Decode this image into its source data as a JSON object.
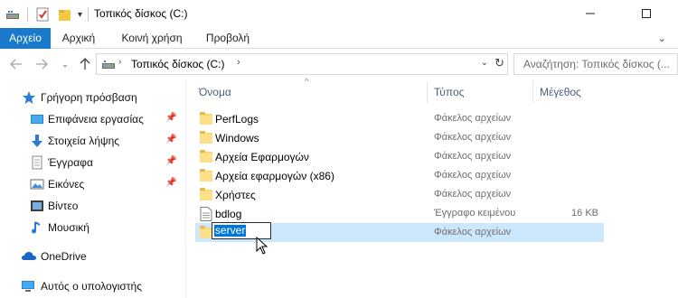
{
  "window": {
    "title": "Τοπικός δίσκος (C:)",
    "minimize_icon": "minimize-icon",
    "maximize_icon": "maximize-icon"
  },
  "ribbon": {
    "tabs": [
      {
        "label": "Αρχείο",
        "active": true
      },
      {
        "label": "Αρχική",
        "active": false
      },
      {
        "label": "Κοινή χρήση",
        "active": false
      },
      {
        "label": "Προβολή",
        "active": false
      }
    ],
    "accent_color": "#1979ca"
  },
  "address_bar": {
    "path": "Τοπικός δίσκος (C:)",
    "search_placeholder": "Αναζήτηση: Τοπικός δίσκος (..."
  },
  "nav_pane": {
    "items": [
      {
        "label": "Γρήγορη πρόσβαση",
        "icon": "star-icon"
      },
      {
        "label": "Επιφάνεια εργασίας",
        "icon": "desktop-icon",
        "pinned": true
      },
      {
        "label": "Στοιχεία λήψης",
        "icon": "download-icon",
        "pinned": true
      },
      {
        "label": "Έγγραφα",
        "icon": "documents-icon",
        "pinned": true
      },
      {
        "label": "Εικόνες",
        "icon": "pictures-icon",
        "pinned": true
      },
      {
        "label": "Βίντεο",
        "icon": "videos-icon"
      },
      {
        "label": "Μουσική",
        "icon": "music-icon"
      },
      {
        "label": "OneDrive",
        "icon": "cloud-icon"
      },
      {
        "label": "Αυτός ο υπολογιστής",
        "icon": "computer-icon"
      }
    ]
  },
  "file_list": {
    "columns": {
      "name": "Όνομα",
      "type": "Τύπος",
      "size": "Μέγεθος"
    },
    "rows": [
      {
        "name": "PerfLogs",
        "type": "Φάκελος αρχείων",
        "size": "",
        "kind": "folder"
      },
      {
        "name": "Windows",
        "type": "Φάκελος αρχείων",
        "size": "",
        "kind": "folder"
      },
      {
        "name": "Αρχεία Εφαρμογών",
        "type": "Φάκελος αρχείων",
        "size": "",
        "kind": "folder"
      },
      {
        "name": "Αρχεία εφαρμογών (x86)",
        "type": "Φάκελος αρχείων",
        "size": "",
        "kind": "folder"
      },
      {
        "name": "Χρήστες",
        "type": "Φάκελος αρχείων",
        "size": "",
        "kind": "folder"
      },
      {
        "name": "bdlog",
        "type": "Έγγραφο κειμένου",
        "size": "16 KB",
        "kind": "text-file"
      },
      {
        "name": "",
        "type": "Φάκελος αρχείων",
        "size": "",
        "kind": "folder",
        "selected": true
      }
    ],
    "rename_value": "server",
    "selection_color": "#cce8ff"
  }
}
